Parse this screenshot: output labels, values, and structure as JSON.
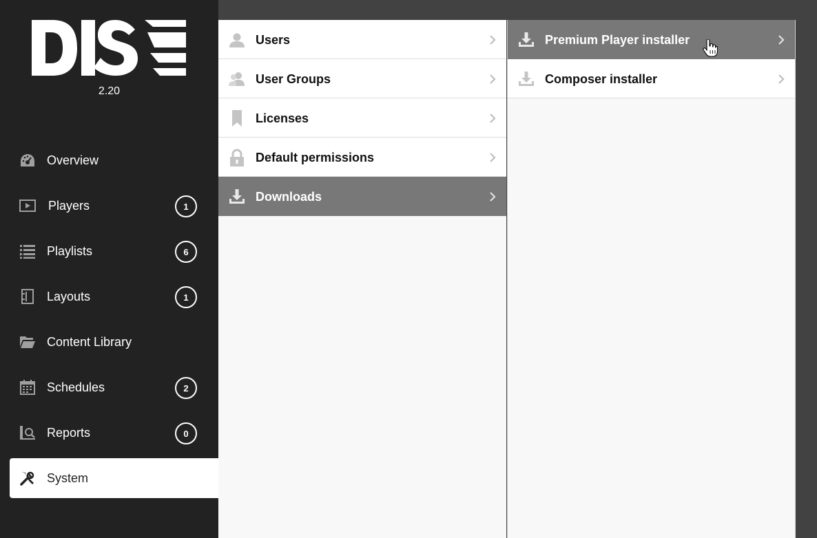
{
  "app": {
    "logo_text": "DISE",
    "version": "2.20"
  },
  "sidebar": {
    "items": [
      {
        "label": "Overview",
        "icon": "dashboard-icon",
        "badge": null
      },
      {
        "label": "Players",
        "icon": "play-icon",
        "badge": "1"
      },
      {
        "label": "Playlists",
        "icon": "list-icon",
        "badge": "6"
      },
      {
        "label": "Layouts",
        "icon": "layout-icon",
        "badge": "1"
      },
      {
        "label": "Content Library",
        "icon": "folder-icon",
        "badge": null
      },
      {
        "label": "Schedules",
        "icon": "calendar-icon",
        "badge": "2"
      },
      {
        "label": "Reports",
        "icon": "report-icon",
        "badge": "0"
      },
      {
        "label": "System",
        "icon": "wrench-icon",
        "badge": null,
        "active": true
      }
    ]
  },
  "system_menu": {
    "items": [
      {
        "label": "Users",
        "icon": "user-icon"
      },
      {
        "label": "User Groups",
        "icon": "user-group-icon"
      },
      {
        "label": "Licenses",
        "icon": "bookmark-icon"
      },
      {
        "label": "Default permissions",
        "icon": "lock-icon"
      },
      {
        "label": "Downloads",
        "icon": "download-icon",
        "selected": true
      }
    ]
  },
  "downloads_menu": {
    "items": [
      {
        "label": "Premium Player installer",
        "icon": "download-icon",
        "selected": true
      },
      {
        "label": "Composer installer",
        "icon": "download-icon"
      }
    ]
  },
  "colors": {
    "sidebar_bg": "#222222",
    "page_bg": "#424242",
    "selected_row": "#787878",
    "icon_gray": "#b8b8b8"
  }
}
